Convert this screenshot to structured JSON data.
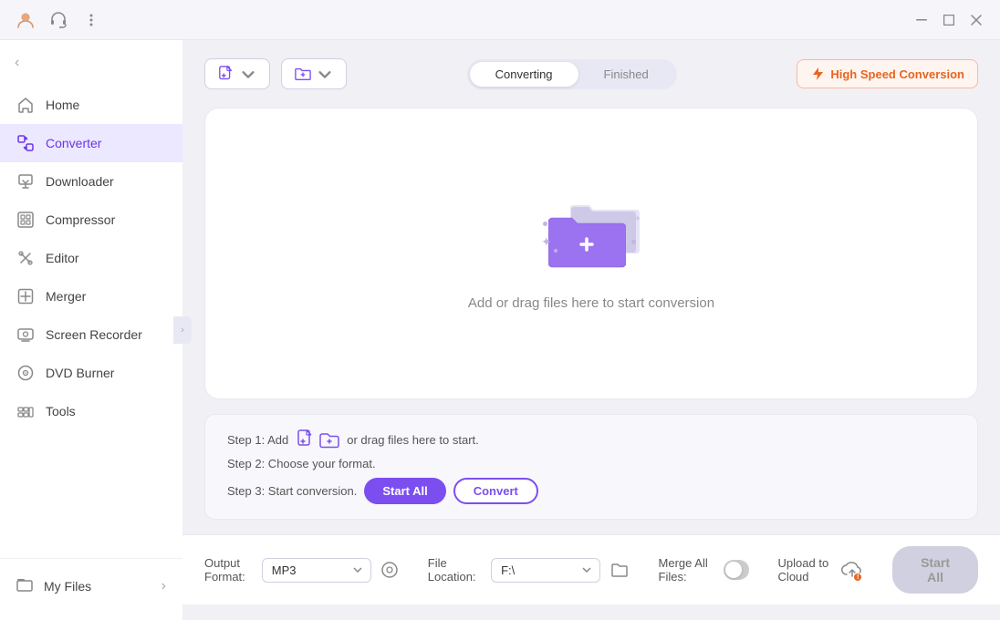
{
  "titlebar": {
    "account_icon": "👤",
    "headset_icon": "🎧",
    "menu_icon": "☰",
    "minimize_icon": "—",
    "maximize_icon": "□",
    "close_icon": "✕"
  },
  "sidebar": {
    "collapse_label": "‹",
    "items": [
      {
        "id": "home",
        "label": "Home",
        "icon": "⌂"
      },
      {
        "id": "converter",
        "label": "Converter",
        "icon": "⟳",
        "active": true
      },
      {
        "id": "downloader",
        "label": "Downloader",
        "icon": "⬇"
      },
      {
        "id": "compressor",
        "label": "Compressor",
        "icon": "⊞"
      },
      {
        "id": "editor",
        "label": "Editor",
        "icon": "✂"
      },
      {
        "id": "merger",
        "label": "Merger",
        "icon": "⊕"
      },
      {
        "id": "screen-recorder",
        "label": "Screen Recorder",
        "icon": "⊙"
      },
      {
        "id": "dvd-burner",
        "label": "DVD Burner",
        "icon": "⊚"
      },
      {
        "id": "tools",
        "label": "Tools",
        "icon": "⚙"
      }
    ],
    "my_files_label": "My Files",
    "my_files_arrow": "›"
  },
  "toolbar": {
    "add_file_label": "Add File",
    "add_folder_label": "Add Folder",
    "tab_converting": "Converting",
    "tab_finished": "Finished",
    "high_speed_label": "High Speed Conversion",
    "high_speed_color": "#e86520"
  },
  "dropzone": {
    "text": "Add or drag files here to start conversion"
  },
  "steps": {
    "step1_prefix": "Step 1: Add",
    "step1_suffix": "or drag files here to start.",
    "step2": "Step 2: Choose your format.",
    "step3_prefix": "Step 3: Start conversion.",
    "start_all_label": "Start All",
    "convert_label": "Convert"
  },
  "bottom_bar": {
    "output_format_label": "Output Format:",
    "output_format_value": "MP3",
    "file_location_label": "File Location:",
    "file_location_value": "F:\\",
    "merge_all_label": "Merge All Files:",
    "upload_cloud_label": "Upload to Cloud",
    "start_all_label": "Start All"
  }
}
